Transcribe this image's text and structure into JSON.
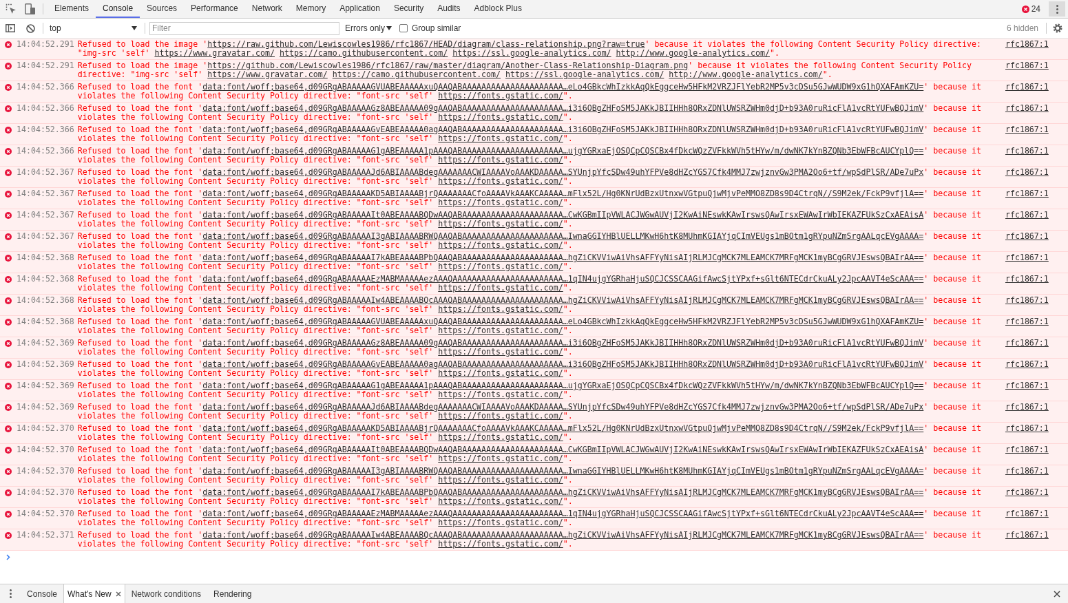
{
  "panel_tabs": [
    {
      "label": "Elements",
      "selected": false
    },
    {
      "label": "Console",
      "selected": true
    },
    {
      "label": "Sources",
      "selected": false
    },
    {
      "label": "Performance",
      "selected": false
    },
    {
      "label": "Network",
      "selected": false
    },
    {
      "label": "Memory",
      "selected": false
    },
    {
      "label": "Application",
      "selected": false
    },
    {
      "label": "Security",
      "selected": false
    },
    {
      "label": "Audits",
      "selected": false
    },
    {
      "label": "Adblock Plus",
      "selected": false
    }
  ],
  "error_count": "24",
  "console_toolbar": {
    "context": "top",
    "filter": {
      "placeholder": "Filter"
    },
    "level_filter": "Errors only",
    "group_similar": {
      "label": "Group similar",
      "checked": false
    },
    "hidden_count": "6 hidden"
  },
  "messages": [
    {
      "time": "14:04:52.291",
      "parts": [
        {
          "kind": "text",
          "text": "Refused to load the image '"
        },
        {
          "kind": "link",
          "text": "https://raw.github.com/Lewiscowles1986/rfc1867/HEAD/diagram/class-relationship.png?raw=true"
        },
        {
          "kind": "text",
          "text": "' because it violates the following Content Security Policy directive: \"img-src 'self' "
        },
        {
          "kind": "link",
          "text": "https://www.gravatar.com/"
        },
        {
          "kind": "link",
          "text": "https://camo.githubusercontent.com/"
        },
        {
          "kind": "link",
          "text": "https://ssl.google-analytics.com/"
        },
        {
          "kind": "link",
          "text": "http://www.google-analytics.com/"
        },
        {
          "kind": "text",
          "text": "\"."
        }
      ],
      "source": "rfc1867:1"
    },
    {
      "time": "14:04:52.291",
      "parts": [
        {
          "kind": "text",
          "text": "Refused to load the image '"
        },
        {
          "kind": "link",
          "text": "https://github.com/Lewiscowles1986/rfc1867/raw/master/diagram/Another-Class-Relationship-Diagram.png"
        },
        {
          "kind": "text",
          "text": "' because it violates the following Content Security Policy directive: \"img-src 'self' "
        },
        {
          "kind": "link",
          "text": "https://www.gravatar.com/"
        },
        {
          "kind": "link",
          "text": "https://camo.githubusercontent.com/"
        },
        {
          "kind": "link",
          "text": "https://ssl.google-analytics.com/"
        },
        {
          "kind": "link",
          "text": "http://www.google-analytics.com/"
        },
        {
          "kind": "text",
          "text": "\"."
        }
      ],
      "source": "rfc1867:1"
    },
    {
      "time": "14:04:52.366",
      "parts": [
        {
          "kind": "text",
          "text": "Refused to load the font '"
        },
        {
          "kind": "link",
          "text": "data:font/woff;base64,d09GRgABAAAAAGVUABEAAAAAxuQAAQABAAAAAAAAAAAAAAAAAAAAA…eLo4GBkcWhIzkkAqQkEggceHw5HFkM2VRZJFlYebR2MP5v3cDSu5GJwWUDW9xG1hQXAFAmKZU="
        },
        {
          "kind": "text",
          "text": "' because it violates the following Content Security Policy directive: \"font-src 'self' "
        },
        {
          "kind": "link",
          "text": "https://fonts.gstatic.com/"
        },
        {
          "kind": "text",
          "text": "\"."
        }
      ],
      "source": "rfc1867:1"
    },
    {
      "time": "14:04:52.366",
      "parts": [
        {
          "kind": "text",
          "text": "Refused to load the font '"
        },
        {
          "kind": "link",
          "text": "data:font/woff;base64,d09GRgABAAAAAGz8ABEAAAAA09gAAQABAAAAAAAAAAAAAAAAAAAAA…i3i6OBgZHFoSM5JAKkJBIIHHh8ORxZDNlUWSRZWHm0djD+b93A0ruRicFlA1vcRtYUFwBQJimV"
        },
        {
          "kind": "text",
          "text": "' because it violates the following Content Security Policy directive: \"font-src 'self' "
        },
        {
          "kind": "link",
          "text": "https://fonts.gstatic.com/"
        },
        {
          "kind": "text",
          "text": "\"."
        }
      ],
      "source": "rfc1867:1"
    },
    {
      "time": "14:04:52.366",
      "parts": [
        {
          "kind": "text",
          "text": "Refused to load the font '"
        },
        {
          "kind": "link",
          "text": "data:font/woff;base64,d09GRgABAAAAAGvEABEAAAAA0agAAQABAAAAAAAAAAAAAAAAAAAAA…i3i6OBgZHFoSM5JAKkJBIIHHh8ORxZDNlUWSRZWHm0djD+b93A0ruRicFlA1vcRtYUFwBQJimV"
        },
        {
          "kind": "text",
          "text": "' because it violates the following Content Security Policy directive: \"font-src 'self' "
        },
        {
          "kind": "link",
          "text": "https://fonts.gstatic.com/"
        },
        {
          "kind": "text",
          "text": "\"."
        }
      ],
      "source": "rfc1867:1"
    },
    {
      "time": "14:04:52.366",
      "parts": [
        {
          "kind": "text",
          "text": "Refused to load the font '"
        },
        {
          "kind": "link",
          "text": "data:font/woff;base64,d09GRgABAAAAAG1gABEAAAAA1pAAAQABAAAAAAAAAAAAAAAAAAAAA…ujgYGRxaEjOSQCpCQSCBx4fDkcWQzZVFkkWVh5tHYw/m/dwNK7kYnBZQNb3EbWFBcAUCYplQ=="
        },
        {
          "kind": "text",
          "text": "' because it violates the following Content Security Policy directive: \"font-src 'self' "
        },
        {
          "kind": "link",
          "text": "https://fonts.gstatic.com/"
        },
        {
          "kind": "text",
          "text": "\"."
        }
      ],
      "source": "rfc1867:1"
    },
    {
      "time": "14:04:52.367",
      "parts": [
        {
          "kind": "text",
          "text": "Refused to load the font '"
        },
        {
          "kind": "link",
          "text": "data:font/woff;base64,d09GRgABAAAAAJd6ABIAAAABdegAAAAAAACWIAAAAVoAAAKDAAAAA…SYUnjpYfcSDw49uhYFPVe8dHZcYGS7Cfk4MMJ7zwjznvGw3PMA2Oo6+tf/wpSdPlSR/ADe7uPx"
        },
        {
          "kind": "text",
          "text": "' because it violates the following Content Security Policy directive: \"font-src 'self' "
        },
        {
          "kind": "link",
          "text": "https://fonts.gstatic.com/"
        },
        {
          "kind": "text",
          "text": "\"."
        }
      ],
      "source": "rfc1867:1"
    },
    {
      "time": "14:04:52.367",
      "parts": [
        {
          "kind": "text",
          "text": "Refused to load the font '"
        },
        {
          "kind": "link",
          "text": "data:font/woff;base64,d09GRgABAAAAAKD5ABIAAAABjrQAAAAAAACfoAAAAVkAAAKCAAAAA…mFlx52L/Hg0KNrUdBzxUtnxwVGtpuQjwMjvPeMMO8ZD8s9D4CtrqN//S9M2ek/FckP9vfjlA=="
        },
        {
          "kind": "text",
          "text": "' because it violates the following Content Security Policy directive: \"font-src 'self' "
        },
        {
          "kind": "link",
          "text": "https://fonts.gstatic.com/"
        },
        {
          "kind": "text",
          "text": "\"."
        }
      ],
      "source": "rfc1867:1"
    },
    {
      "time": "14:04:52.367",
      "parts": [
        {
          "kind": "text",
          "text": "Refused to load the font '"
        },
        {
          "kind": "link",
          "text": "data:font/woff;base64,d09GRgABAAAAAIt0ABEAAAABQDwAAQABAAAAAAAAAAAAAAAAAAAAA…CwKGBmIIpVWLACJWGwAUVjI2KwAiNEswkKAwIrswsQAwIrsxEWAwIrWbIEKAZFUkSzCxAEAisA"
        },
        {
          "kind": "text",
          "text": "' because it violates the following Content Security Policy directive: \"font-src 'self' "
        },
        {
          "kind": "link",
          "text": "https://fonts.gstatic.com/"
        },
        {
          "kind": "text",
          "text": "\"."
        }
      ],
      "source": "rfc1867:1"
    },
    {
      "time": "14:04:52.367",
      "parts": [
        {
          "kind": "text",
          "text": "Refused to load the font '"
        },
        {
          "kind": "link",
          "text": "data:font/woff;base64,d09GRgABAAAAAI3gABIAAAABRWQAAQABAAAAAAAAAAAAAAAAAAAAA…IwnaGGIYHBlUELLMKwH6htK8MUhmKGIAYjqCImVEUgs1mBOtm1gRYpuNZmSrgAALqcEVgAAAA="
        },
        {
          "kind": "text",
          "text": "' because it violates the following Content Security Policy directive: \"font-src 'self' "
        },
        {
          "kind": "link",
          "text": "https://fonts.gstatic.com/"
        },
        {
          "kind": "text",
          "text": "\"."
        }
      ],
      "source": "rfc1867:1"
    },
    {
      "time": "14:04:52.368",
      "parts": [
        {
          "kind": "text",
          "text": "Refused to load the font '"
        },
        {
          "kind": "link",
          "text": "data:font/woff;base64,d09GRgABAAAAAI7kABEAAAABPbQAAQABAAAAAAAAAAAAAAAAAAAAA…hgZiCKVViwAiVhsAFFYyNisAIjRLMJCgMCK7MLEAMCK7MRFgMCK1myBCgGRVJEswsQBAIrAA=="
        },
        {
          "kind": "text",
          "text": "' because it violates the following Content Security Policy directive: \"font-src 'self' "
        },
        {
          "kind": "link",
          "text": "https://fonts.gstatic.com/"
        },
        {
          "kind": "text",
          "text": "\"."
        }
      ],
      "source": "rfc1867:1"
    },
    {
      "time": "14:04:52.368",
      "parts": [
        {
          "kind": "text",
          "text": "Refused to load the font '"
        },
        {
          "kind": "link",
          "text": "data:font/woff;base64,d09GRgABAAAAAEzMABMAAAAAezAAAQAAAAAAAAAAAAAAAAAAAAAAA…1qIN4ujgYGRhaHjuSQCJCSSCAAGifAwcSjtYPxf+sGlt6NTECdrCkuALy2JpcAAVT4eScAAA=="
        },
        {
          "kind": "text",
          "text": "' because it violates the following Content Security Policy directive: \"font-src 'self' "
        },
        {
          "kind": "link",
          "text": "https://fonts.gstatic.com/"
        },
        {
          "kind": "text",
          "text": "\"."
        }
      ],
      "source": "rfc1867:1"
    },
    {
      "time": "14:04:52.368",
      "parts": [
        {
          "kind": "text",
          "text": "Refused to load the font '"
        },
        {
          "kind": "link",
          "text": "data:font/woff;base64,d09GRgABAAAAAIw4ABEAAAABQcAAAQABAAAAAAAAAAAAAAAAAAAAA…hgZiCKVViwAiVhsAFFYyNisAIjRLMJCgMCK7MLEAMCK7MRFgMCK1myBCgGRVJEswsQBAIrAA=="
        },
        {
          "kind": "text",
          "text": "' because it violates the following Content Security Policy directive: \"font-src 'self' "
        },
        {
          "kind": "link",
          "text": "https://fonts.gstatic.com/"
        },
        {
          "kind": "text",
          "text": "\"."
        }
      ],
      "source": "rfc1867:1"
    },
    {
      "time": "14:04:52.368",
      "parts": [
        {
          "kind": "text",
          "text": "Refused to load the font '"
        },
        {
          "kind": "link",
          "text": "data:font/woff;base64,d09GRgABAAAAAGVUABEAAAAAxuQAAQABAAAAAAAAAAAAAAAAAAAAA…eLo4GBkcWhIzkkAqQkEggceHw5HFkM2VRZJFlYebR2MP5v3cDSu5GJwWUDW9xG1hQXAFAmKZU="
        },
        {
          "kind": "text",
          "text": "' because it violates the following Content Security Policy directive: \"font-src 'self' "
        },
        {
          "kind": "link",
          "text": "https://fonts.gstatic.com/"
        },
        {
          "kind": "text",
          "text": "\"."
        }
      ],
      "source": "rfc1867:1"
    },
    {
      "time": "14:04:52.369",
      "parts": [
        {
          "kind": "text",
          "text": "Refused to load the font '"
        },
        {
          "kind": "link",
          "text": "data:font/woff;base64,d09GRgABAAAAAGz8ABEAAAAA09gAAQABAAAAAAAAAAAAAAAAAAAAA…i3i6OBgZHFoSM5JAKkJBIIHHh8ORxZDNlUWSRZWHm0djD+b93A0ruRicFlA1vcRtYUFwBQJimV"
        },
        {
          "kind": "text",
          "text": "' because it violates the following Content Security Policy directive: \"font-src 'self' "
        },
        {
          "kind": "link",
          "text": "https://fonts.gstatic.com/"
        },
        {
          "kind": "text",
          "text": "\"."
        }
      ],
      "source": "rfc1867:1"
    },
    {
      "time": "14:04:52.369",
      "parts": [
        {
          "kind": "text",
          "text": "Refused to load the font '"
        },
        {
          "kind": "link",
          "text": "data:font/woff;base64,d09GRgABAAAAAGvEABEAAAAA0agAAQABAAAAAAAAAAAAAAAAAAAAA…i3i6OBgZHFoSM5JAKkJBIIHHh8ORxZDNlUWSRZWHm0djD+b93A0ruRicFlA1vcRtYUFwBQJimV"
        },
        {
          "kind": "text",
          "text": "' because it violates the following Content Security Policy directive: \"font-src 'self' "
        },
        {
          "kind": "link",
          "text": "https://fonts.gstatic.com/"
        },
        {
          "kind": "text",
          "text": "\"."
        }
      ],
      "source": "rfc1867:1"
    },
    {
      "time": "14:04:52.369",
      "parts": [
        {
          "kind": "text",
          "text": "Refused to load the font '"
        },
        {
          "kind": "link",
          "text": "data:font/woff;base64,d09GRgABAAAAAG1gABEAAAAA1pAAAQABAAAAAAAAAAAAAAAAAAAAA…ujgYGRxaEjOSQCpCQSCBx4fDkcWQzZVFkkWVh5tHYw/m/dwNK7kYnBZQNb3EbWFBcAUCYplQ=="
        },
        {
          "kind": "text",
          "text": "' because it violates the following Content Security Policy directive: \"font-src 'self' "
        },
        {
          "kind": "link",
          "text": "https://fonts.gstatic.com/"
        },
        {
          "kind": "text",
          "text": "\"."
        }
      ],
      "source": "rfc1867:1"
    },
    {
      "time": "14:04:52.369",
      "parts": [
        {
          "kind": "text",
          "text": "Refused to load the font '"
        },
        {
          "kind": "link",
          "text": "data:font/woff;base64,d09GRgABAAAAAJd6ABIAAAABdegAAAAAAACWIAAAAVoAAAKDAAAAA…SYUnjpYfcSDw49uhYFPVe8dHZcYGS7Cfk4MMJ7zwjznvGw3PMA2Oo6+tf/wpSdPlSR/ADe7uPx"
        },
        {
          "kind": "text",
          "text": "' because it violates the following Content Security Policy directive: \"font-src 'self' "
        },
        {
          "kind": "link",
          "text": "https://fonts.gstatic.com/"
        },
        {
          "kind": "text",
          "text": "\"."
        }
      ],
      "source": "rfc1867:1"
    },
    {
      "time": "14:04:52.370",
      "parts": [
        {
          "kind": "text",
          "text": "Refused to load the font '"
        },
        {
          "kind": "link",
          "text": "data:font/woff;base64,d09GRgABAAAAAKD5ABIAAAABjrQAAAAAAACfoAAAAVkAAAKCAAAAA…mFlx52L/Hg0KNrUdBzxUtnxwVGtpuQjwMjvPeMMO8ZD8s9D4CtrqN//S9M2ek/FckP9vfjlA=="
        },
        {
          "kind": "text",
          "text": "' because it violates the following Content Security Policy directive: \"font-src 'self' "
        },
        {
          "kind": "link",
          "text": "https://fonts.gstatic.com/"
        },
        {
          "kind": "text",
          "text": "\"."
        }
      ],
      "source": "rfc1867:1"
    },
    {
      "time": "14:04:52.370",
      "parts": [
        {
          "kind": "text",
          "text": "Refused to load the font '"
        },
        {
          "kind": "link",
          "text": "data:font/woff;base64,d09GRgABAAAAAIt0ABEAAAABQDwAAQABAAAAAAAAAAAAAAAAAAAAA…CwKGBmIIpVWLACJWGwAUVjI2KwAiNEswkKAwIrswsQAwIrsxEWAwIrWbIEKAZFUkSzCxAEAisA"
        },
        {
          "kind": "text",
          "text": "' because it violates the following Content Security Policy directive: \"font-src 'self' "
        },
        {
          "kind": "link",
          "text": "https://fonts.gstatic.com/"
        },
        {
          "kind": "text",
          "text": "\"."
        }
      ],
      "source": "rfc1867:1"
    },
    {
      "time": "14:04:52.370",
      "parts": [
        {
          "kind": "text",
          "text": "Refused to load the font '"
        },
        {
          "kind": "link",
          "text": "data:font/woff;base64,d09GRgABAAAAAI3gABIAAAABRWQAAQABAAAAAAAAAAAAAAAAAAAAA…IwnaGGIYHBlUELLMKwH6htK8MUhmKGIAYjqCImVEUgs1mBOtm1gRYpuNZmSrgAALqcEVgAAAA="
        },
        {
          "kind": "text",
          "text": "' because it violates the following Content Security Policy directive: \"font-src 'self' "
        },
        {
          "kind": "link",
          "text": "https://fonts.gstatic.com/"
        },
        {
          "kind": "text",
          "text": "\"."
        }
      ],
      "source": "rfc1867:1"
    },
    {
      "time": "14:04:52.370",
      "parts": [
        {
          "kind": "text",
          "text": "Refused to load the font '"
        },
        {
          "kind": "link",
          "text": "data:font/woff;base64,d09GRgABAAAAAI7kABEAAAABPbQAAQABAAAAAAAAAAAAAAAAAAAAA…hgZiCKVViwAiVhsAFFYyNisAIjRLMJCgMCK7MLEAMCK7MRFgMCK1myBCgGRVJEswsQBAIrAA=="
        },
        {
          "kind": "text",
          "text": "' because it violates the following Content Security Policy directive: \"font-src 'self' "
        },
        {
          "kind": "link",
          "text": "https://fonts.gstatic.com/"
        },
        {
          "kind": "text",
          "text": "\"."
        }
      ],
      "source": "rfc1867:1"
    },
    {
      "time": "14:04:52.370",
      "parts": [
        {
          "kind": "text",
          "text": "Refused to load the font '"
        },
        {
          "kind": "link",
          "text": "data:font/woff;base64,d09GRgABAAAAAEzMABMAAAAAezAAAQAAAAAAAAAAAAAAAAAAAAAAA…1qIN4ujgYGRhaHjuSQCJCSSCAAGifAwcSjtYPxf+sGlt6NTECdrCkuALy2JpcAAVT4eScAAA=="
        },
        {
          "kind": "text",
          "text": "' because it violates the following Content Security Policy directive: \"font-src 'self' "
        },
        {
          "kind": "link",
          "text": "https://fonts.gstatic.com/"
        },
        {
          "kind": "text",
          "text": "\"."
        }
      ],
      "source": "rfc1867:1"
    },
    {
      "time": "14:04:52.371",
      "parts": [
        {
          "kind": "text",
          "text": "Refused to load the font '"
        },
        {
          "kind": "link",
          "text": "data:font/woff;base64,d09GRgABAAAAAIw4ABEAAAABQcAAAQABAAAAAAAAAAAAAAAAAAAAA…hgZiCKVViwAiVhsAFFYyNisAIjRLMJCgMCK7MLEAMCK7MRFgMCK1myBCgGRVJEswsQBAIrAA=="
        },
        {
          "kind": "text",
          "text": "' because it violates the following Content Security Policy directive: \"font-src 'self' "
        },
        {
          "kind": "link",
          "text": "https://fonts.gstatic.com/"
        },
        {
          "kind": "text",
          "text": "\"."
        }
      ],
      "source": "rfc1867:1"
    }
  ],
  "drawer_tabs": [
    {
      "label": "Console",
      "selected": false,
      "closable": false
    },
    {
      "label": "What's New",
      "selected": true,
      "closable": true
    },
    {
      "label": "Network conditions",
      "selected": false,
      "closable": false
    },
    {
      "label": "Rendering",
      "selected": false,
      "closable": false
    }
  ]
}
